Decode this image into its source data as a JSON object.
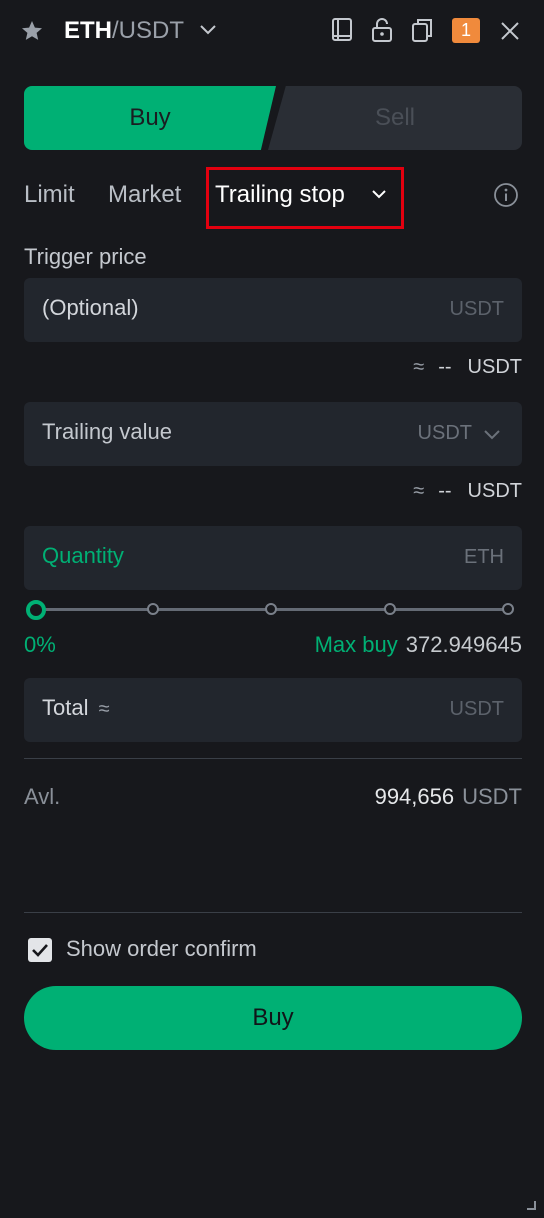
{
  "header": {
    "pair_base": "ETH",
    "pair_quote": "/USDT",
    "notification_count": "1",
    "icons": [
      "star-icon",
      "chevron-down-icon",
      "book-icon",
      "lock-icon",
      "copy-icon",
      "close-icon"
    ]
  },
  "side_tabs": {
    "buy": "Buy",
    "sell": "Sell"
  },
  "order_types": {
    "limit": "Limit",
    "market": "Market",
    "trailing": "Trailing stop",
    "selected": "Trailing stop"
  },
  "trigger": {
    "label": "Trigger price",
    "placeholder": "(Optional)",
    "unit": "USDT",
    "approx_symbol": "≈",
    "approx_value": "--",
    "approx_unit": "USDT"
  },
  "trailing_value": {
    "placeholder": "Trailing value",
    "unit": "USDT",
    "approx_symbol": "≈",
    "approx_value": "--",
    "approx_unit": "USDT"
  },
  "quantity": {
    "placeholder": "Quantity",
    "unit": "ETH"
  },
  "slider": {
    "value_percent": 0,
    "label": "0%",
    "max_buy_label": "Max buy",
    "max_buy_value": "372.949645"
  },
  "total": {
    "label": "Total",
    "approx_symbol": "≈",
    "unit": "USDT"
  },
  "available": {
    "label": "Avl.",
    "value": "994,656",
    "unit": "USDT"
  },
  "confirm": {
    "label": "Show order confirm",
    "checked": true
  },
  "submit": {
    "label": "Buy"
  },
  "colors": {
    "accent_green": "#00b074",
    "highlight_red": "#e3000f",
    "badge_orange": "#f08a3c",
    "background": "#17181c"
  }
}
